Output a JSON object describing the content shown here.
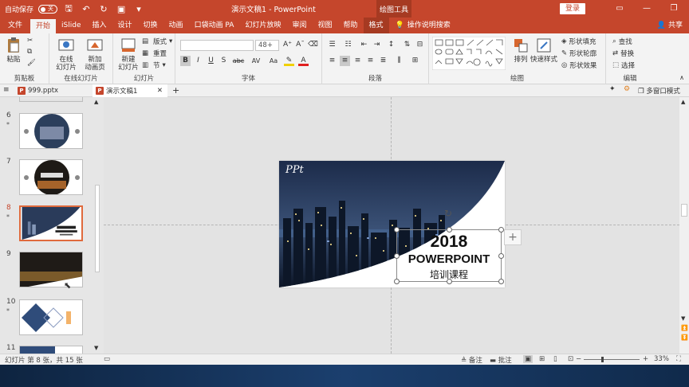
{
  "titlebar": {
    "autosave_label": "自动保存",
    "autosave_state": "关",
    "doc_title": "演示文稿1  -  PowerPoint",
    "context_tools": "绘图工具",
    "login": "登录"
  },
  "tabs": [
    "文件",
    "开始",
    "iSlide",
    "插入",
    "设计",
    "切换",
    "动画",
    "口袋动画 PA",
    "幻灯片放映",
    "审阅",
    "视图",
    "帮助",
    "格式"
  ],
  "active_tab": "开始",
  "tell_me": "操作说明搜索",
  "share": "共享",
  "ribbon": {
    "clipboard": {
      "label": "剪贴板",
      "paste": "粘贴"
    },
    "online_slides": {
      "label": "在线幻灯片",
      "online": "在线\n幻灯片",
      "new_anim": "新加\n动画页"
    },
    "slides": {
      "label": "幻灯片",
      "new_slide": "新建\n幻灯片",
      "layout": "版式",
      "reset": "重置",
      "section": "节"
    },
    "font": {
      "label": "字体",
      "font_name": "",
      "font_size": "48+",
      "bold": "B",
      "italic": "I",
      "underline": "U",
      "shadow": "S",
      "strike": "abc",
      "spacing": "AV",
      "case": "Aa",
      "color": "A"
    },
    "paragraph": {
      "label": "段落"
    },
    "drawing": {
      "label": "绘图",
      "arrange": "排列",
      "quick_styles": "快速样式",
      "fill": "形状填充",
      "outline": "形状轮廓",
      "effects": "形状效果"
    },
    "editing": {
      "label": "编辑",
      "find": "查找",
      "replace": "替换",
      "select": "选择"
    }
  },
  "doc_tabs": [
    {
      "name": "999.pptx"
    },
    {
      "name": "演示文稿1"
    }
  ],
  "multi_window": "多窗口模式",
  "thumbnails": [
    {
      "num": "6",
      "star": "*"
    },
    {
      "num": "7",
      "star": ""
    },
    {
      "num": "8",
      "star": "*"
    },
    {
      "num": "9",
      "star": ""
    },
    {
      "num": "10",
      "star": "*"
    },
    {
      "num": "11",
      "star": ""
    }
  ],
  "slide": {
    "logo": "PPt",
    "year": "2018",
    "title": "POWERPOINT",
    "subtitle": "培训课程"
  },
  "status": {
    "slide_info": "幻灯片 第 8 张，共 15 张",
    "notes": "备注",
    "comments": "批注",
    "zoom": "33%"
  },
  "colors": {
    "accent": "#c5462c",
    "selected_border": "#e06a3c"
  }
}
